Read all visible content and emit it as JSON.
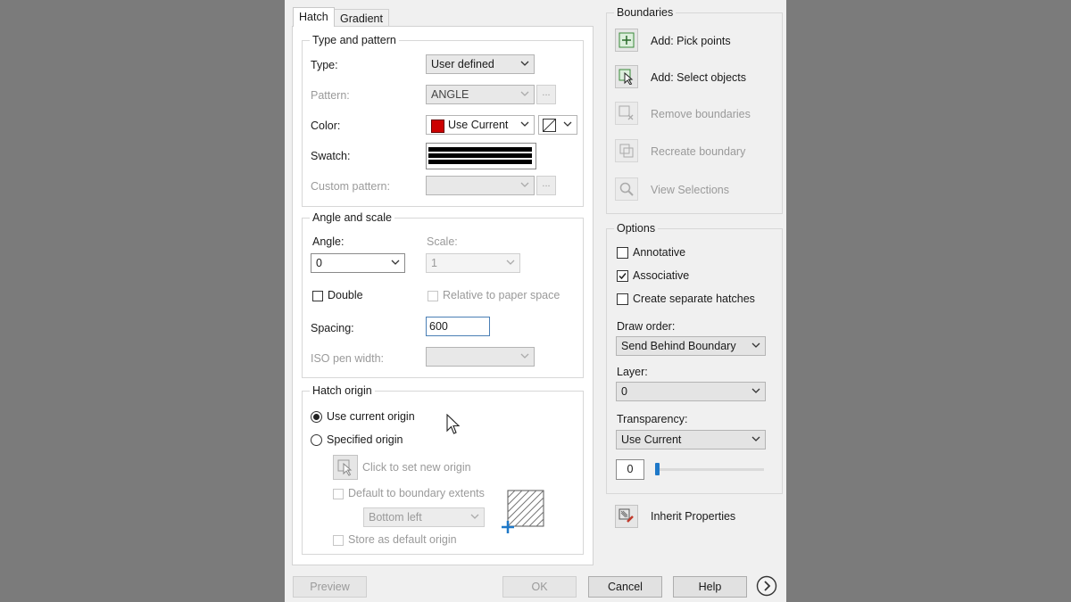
{
  "tabs": {
    "hatch": "Hatch",
    "gradient": "Gradient"
  },
  "type_pattern": {
    "title": "Type and pattern",
    "type_label": "Type:",
    "type_value": "User defined",
    "pattern_label": "Pattern:",
    "pattern_value": "ANGLE",
    "color_label": "Color:",
    "color_value": "Use Current",
    "color_swatch": "#cc0000",
    "swatch_label": "Swatch:",
    "custom_label": "Custom pattern:",
    "dots": "..."
  },
  "angle_scale": {
    "title": "Angle and scale",
    "angle_label": "Angle:",
    "angle_value": "0",
    "scale_label": "Scale:",
    "scale_value": "1",
    "double_label": "Double",
    "relative_label": "Relative to paper space",
    "spacing_label": "Spacing:",
    "spacing_value": "600",
    "iso_label": "ISO pen width:"
  },
  "hatch_origin": {
    "title": "Hatch origin",
    "use_current": "Use current origin",
    "specified": "Specified origin",
    "click_set": "Click to set new origin",
    "default_extents": "Default to boundary extents",
    "position_value": "Bottom left",
    "store_default": "Store as default origin"
  },
  "boundaries": {
    "title": "Boundaries",
    "pick_points": "Add: Pick points",
    "select_objects": "Add: Select objects",
    "remove": "Remove boundaries",
    "recreate": "Recreate boundary",
    "view": "View Selections"
  },
  "options": {
    "title": "Options",
    "annotative": "Annotative",
    "associative": "Associative",
    "associative_checked": true,
    "separate": "Create separate hatches",
    "draw_order_label": "Draw order:",
    "draw_order_value": "Send Behind Boundary",
    "layer_label": "Layer:",
    "layer_value": "0",
    "transparency_label": "Transparency:",
    "transparency_value": "Use Current",
    "transparency_number": "0"
  },
  "inherit": "Inherit Properties",
  "footer": {
    "preview": "Preview",
    "ok": "OK",
    "cancel": "Cancel",
    "help": "Help"
  },
  "colors": {
    "accent": "#1e78c8",
    "disabled": "#9a9a9a"
  }
}
